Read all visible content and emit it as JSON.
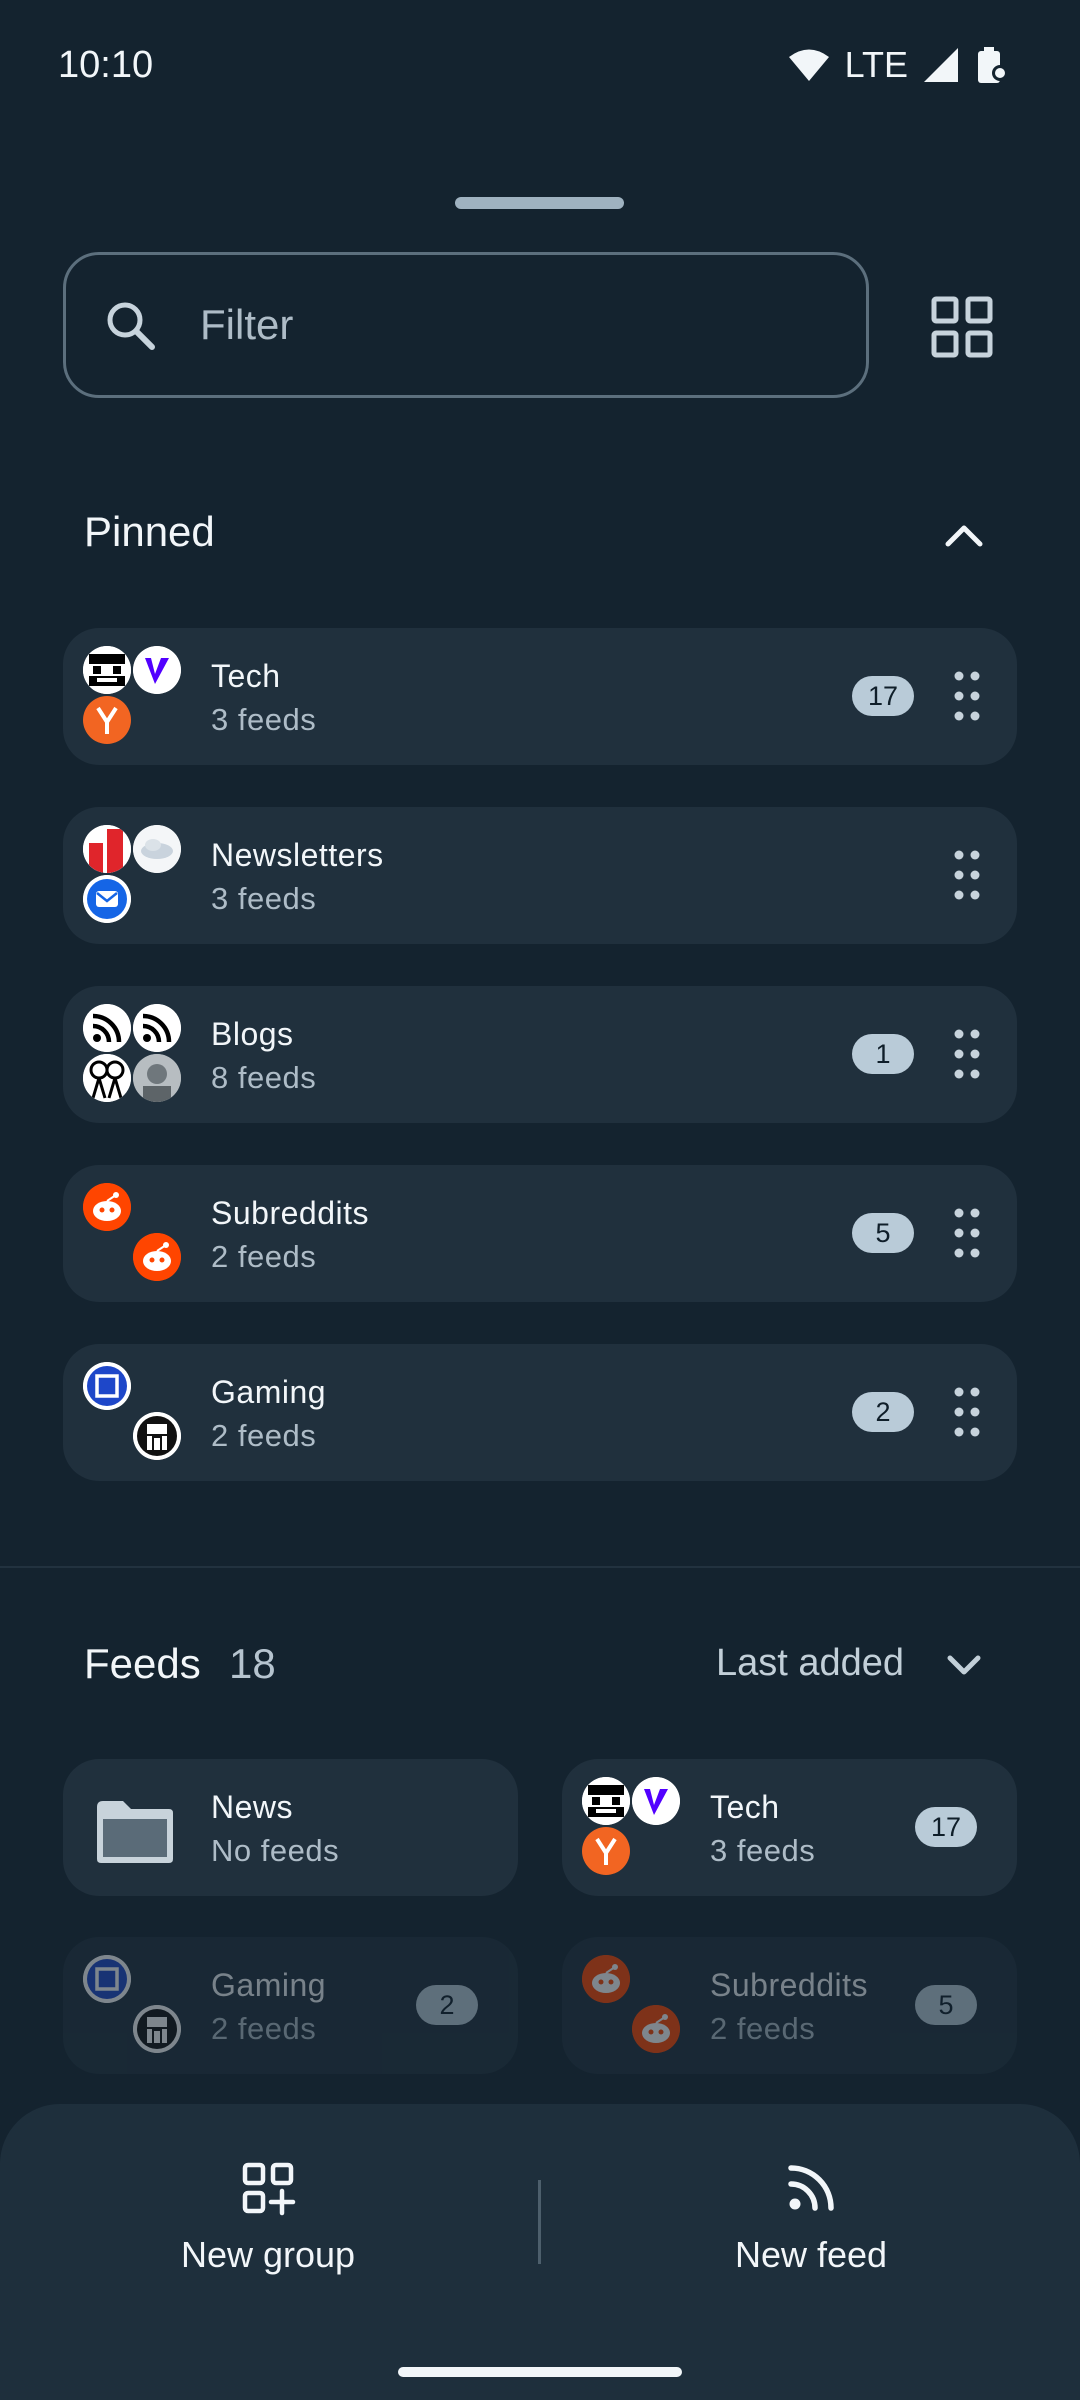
{
  "status_bar": {
    "time": "10:10",
    "network": "LTE"
  },
  "search": {
    "placeholder": "Filter"
  },
  "pinned": {
    "title": "Pinned",
    "groups": [
      {
        "name": "Tech",
        "subtitle": "3 feeds",
        "count": "17",
        "icons": [
          "pixel-face-icon",
          "verge-icon",
          "ycombinator-icon"
        ]
      },
      {
        "name": "Newsletters",
        "subtitle": "3 feeds",
        "icons": [
          "chart-icon",
          "cloud-icon",
          "mail-icon"
        ]
      },
      {
        "name": "Blogs",
        "subtitle": "8 feeds",
        "count": "1",
        "icons": [
          "rss-icon",
          "rss-icon",
          "figures-icon",
          "portrait-icon"
        ]
      },
      {
        "name": "Subreddits",
        "subtitle": "2 feeds",
        "count": "5",
        "icons": [
          "reddit-icon",
          "reddit-icon"
        ]
      },
      {
        "name": "Gaming",
        "subtitle": "2 feeds",
        "count": "2",
        "icons": [
          "square-logo-icon",
          "robot-logo-icon"
        ]
      }
    ]
  },
  "feeds": {
    "title": "Feeds",
    "count": "18",
    "sort_label": "Last added",
    "items": [
      {
        "name": "News",
        "subtitle": "No feeds",
        "icons": [
          "folder-icon"
        ]
      },
      {
        "name": "Tech",
        "subtitle": "3 feeds",
        "count": "17",
        "icons": [
          "pixel-face-icon",
          "verge-icon",
          "ycombinator-icon"
        ]
      },
      {
        "name": "Gaming",
        "subtitle": "2 feeds",
        "count": "2",
        "icons": [
          "square-logo-icon",
          "robot-logo-icon"
        ]
      },
      {
        "name": "Subreddits",
        "subtitle": "2 feeds",
        "count": "5",
        "icons": [
          "reddit-icon",
          "reddit-icon"
        ]
      }
    ]
  },
  "actions": {
    "new_group": "New group",
    "new_feed": "New feed"
  },
  "colors": {
    "background": "#14232f",
    "card": "#20303d",
    "badge": "#b9cbd8",
    "reddit": "#ff4500",
    "ycombinator": "#f26522",
    "verge": "#5200ff"
  }
}
